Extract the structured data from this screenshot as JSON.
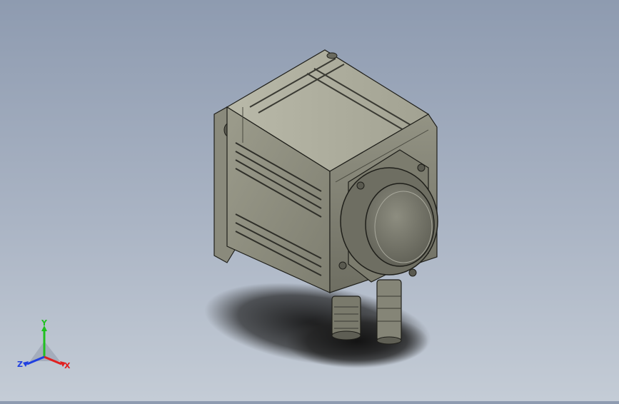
{
  "triad": {
    "x_label": "X",
    "y_label": "Y",
    "z_label": "Z",
    "colors": {
      "x": "#e02020",
      "y": "#20c020",
      "z": "#2040e0"
    }
  },
  "model": {
    "icon": "servo-motor-model",
    "body_color": "#8a8a7c",
    "shadow_color": "#1a1a1a"
  }
}
